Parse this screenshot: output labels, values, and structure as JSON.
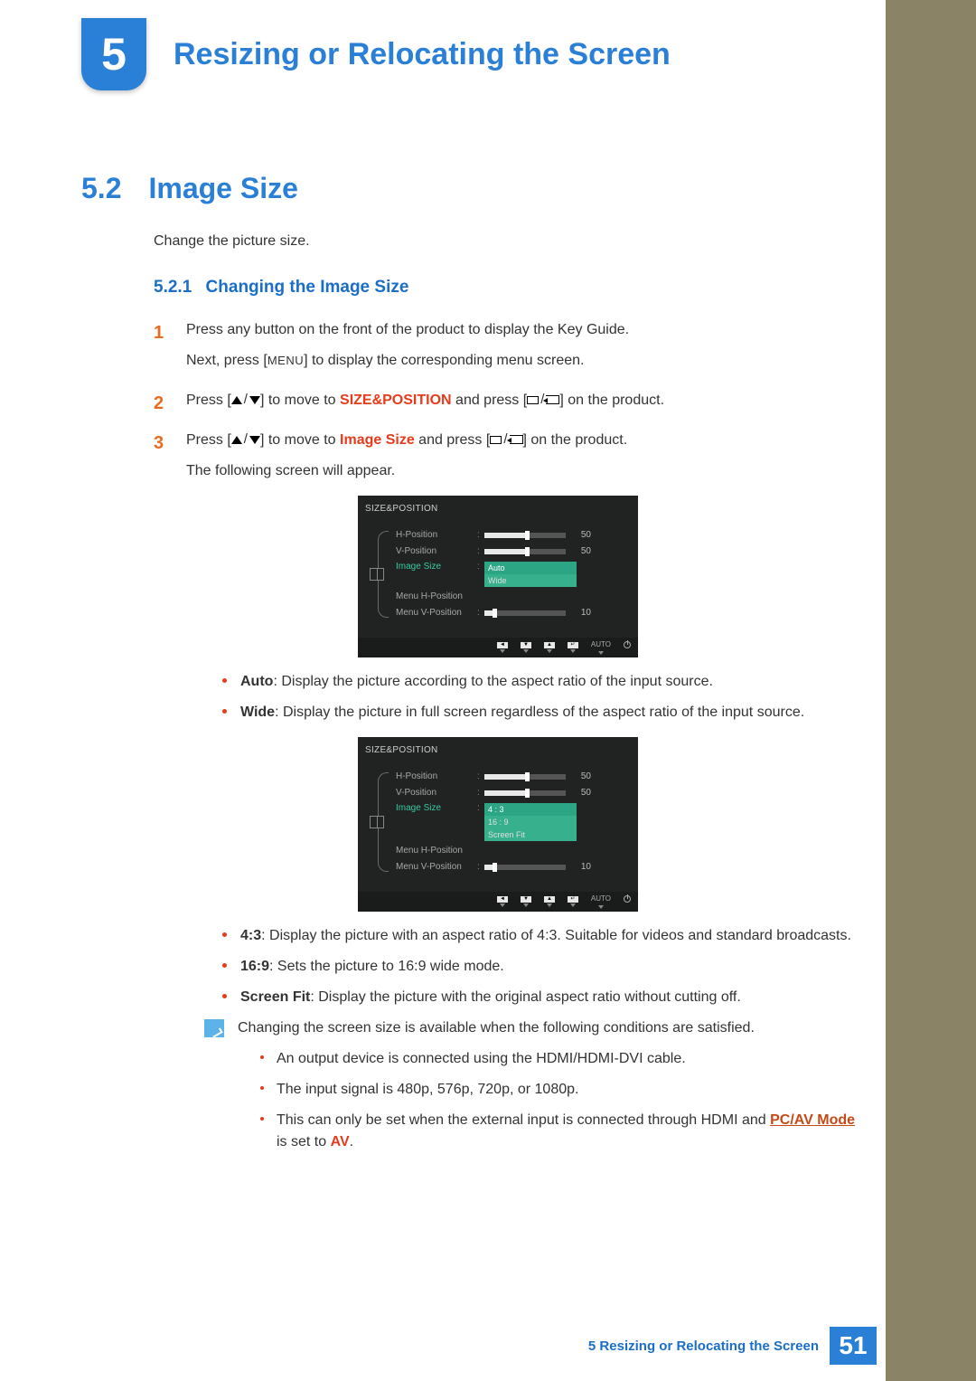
{
  "chapter": {
    "number": "5",
    "title": "Resizing or Relocating the Screen"
  },
  "section": {
    "number": "5.2",
    "title": "Image Size",
    "intro": "Change the picture size."
  },
  "subsection": {
    "number": "5.2.1",
    "title": "Changing the Image Size"
  },
  "steps": {
    "s1": {
      "num": "1",
      "line1": "Press any button on the front of the product to display the Key Guide.",
      "line2a": "Next, press [",
      "menu": "MENU",
      "line2b": "] to display the corresponding menu screen."
    },
    "s2": {
      "num": "2",
      "pre": "Press [",
      "mid": "] to move to ",
      "kw": "SIZE&POSITION",
      "post1": " and press [",
      "post2": "] on the product."
    },
    "s3": {
      "num": "3",
      "pre": "Press [",
      "mid": "] to move to ",
      "kw": "Image Size",
      "post1": " and press [",
      "post2": "] on the product.",
      "line2": "The following screen will appear."
    }
  },
  "osd_common": {
    "title": "SIZE&POSITION",
    "rows": {
      "hpos": "H-Position",
      "vpos": "V-Position",
      "imgsize": "Image Size",
      "mhpos": "Menu H-Position",
      "mvpos": "Menu V-Position"
    },
    "vals": {
      "hpos": "50",
      "vpos": "50",
      "mvpos": "10"
    },
    "footer_auto": "AUTO"
  },
  "osd1_opts": {
    "o1": "Auto",
    "o2": "Wide"
  },
  "osd2_opts": {
    "o1": "4 : 3",
    "o2": "16 : 9",
    "o3": "Screen Fit"
  },
  "bullets1": {
    "b1": {
      "kw": "Auto",
      "txt": ": Display the picture according to the aspect ratio of the input source."
    },
    "b2": {
      "kw": "Wide",
      "txt": ": Display the picture in full screen regardless of the aspect ratio of the input source."
    }
  },
  "bullets2": {
    "b1": {
      "kw": "4:3",
      "txt": ": Display the picture with an aspect ratio of 4:3. Suitable for videos and standard broadcasts."
    },
    "b2": {
      "kw": "16:9",
      "txt": ": Sets the picture to 16:9 wide mode."
    },
    "b3": {
      "kw": "Screen Fit",
      "txt": ": Display the picture with the original aspect ratio without cutting off."
    }
  },
  "note": {
    "lead": "Changing the screen size is available when the following conditions are satisfied.",
    "n1": "An output device is connected using the HDMI/HDMI-DVI cable.",
    "n2": "The input signal is 480p, 576p, 720p, or 1080p.",
    "n3a": "This can only be set when the external input is connected through HDMI and ",
    "n3link": "PC/AV Mode",
    "n3b": " is set to ",
    "n3kw": "AV",
    "n3c": "."
  },
  "footer": {
    "text": "5 Resizing or Relocating the Screen",
    "page": "51"
  }
}
